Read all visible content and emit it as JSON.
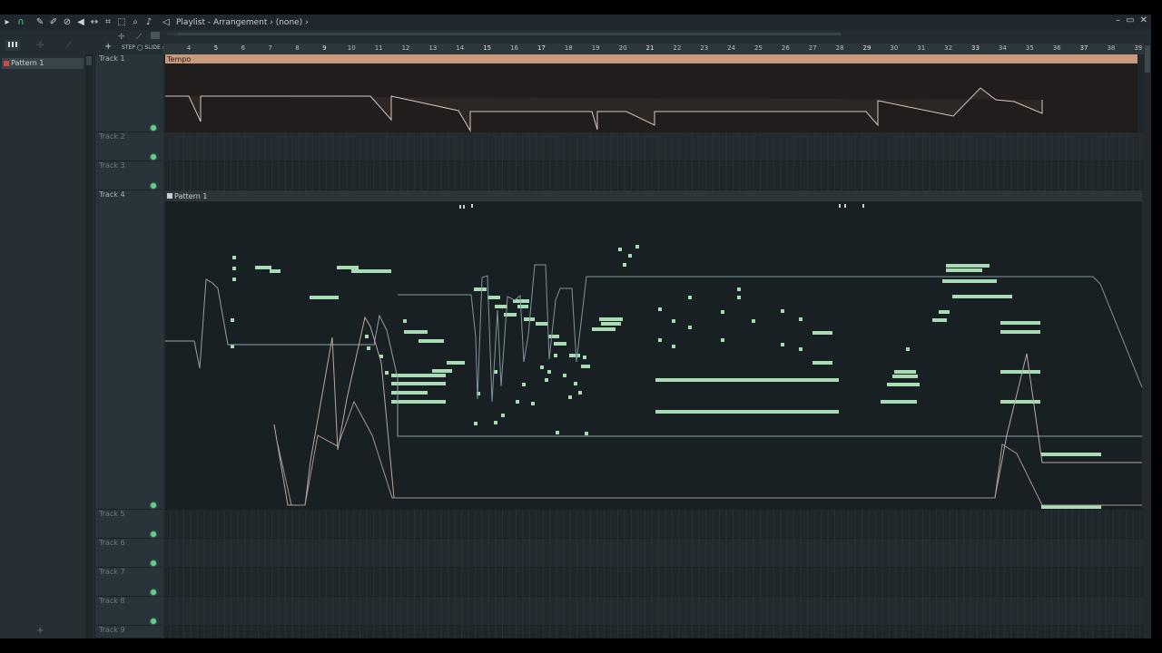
{
  "window": {
    "title_parts": [
      "Playlist",
      "Arrangement",
      "(none)"
    ],
    "title_sep1": " - ",
    "title_sep2": " › ",
    "controls": [
      "–",
      "▭",
      "✕"
    ]
  },
  "toolbar": {
    "icons": [
      "magnet-icon",
      "pencil-icon",
      "brush-icon",
      "delete-icon",
      "mute-icon",
      "slip-icon",
      "slice-icon",
      "select-icon",
      "zoom-icon",
      "speaker-icon"
    ],
    "snap_labels": [
      "STEP",
      "SLIDE"
    ]
  },
  "picker": {
    "pattern_label": "Pattern 1",
    "add_symbol": "+"
  },
  "ruler": {
    "bars": [
      "4",
      "5",
      "6",
      "7",
      "8",
      "9",
      "10",
      "11",
      "12",
      "13",
      "14",
      "15",
      "16",
      "17",
      "18",
      "19",
      "20",
      "21",
      "22",
      "23",
      "24",
      "25",
      "26",
      "27",
      "28",
      "29",
      "30",
      "31",
      "32",
      "33",
      "34",
      "35",
      "36",
      "37",
      "38",
      "39"
    ]
  },
  "tracks": [
    {
      "name": "Track 1",
      "active": true
    },
    {
      "name": "Track 2",
      "active": false
    },
    {
      "name": "Track 3",
      "active": false
    },
    {
      "name": "Track 4",
      "active": true
    },
    {
      "name": "Track 5",
      "active": false
    },
    {
      "name": "Track 6",
      "active": false
    },
    {
      "name": "Track 7",
      "active": false
    },
    {
      "name": "Track 8",
      "active": false
    },
    {
      "name": "Track 9",
      "active": false
    }
  ],
  "clips": {
    "tempo_label": "Tempo",
    "pattern_label": "Pattern 1"
  },
  "colors": {
    "tempo_clip": "#c79a7c",
    "note_green": "#a8dcb4",
    "led_green": "#5fd08d"
  }
}
